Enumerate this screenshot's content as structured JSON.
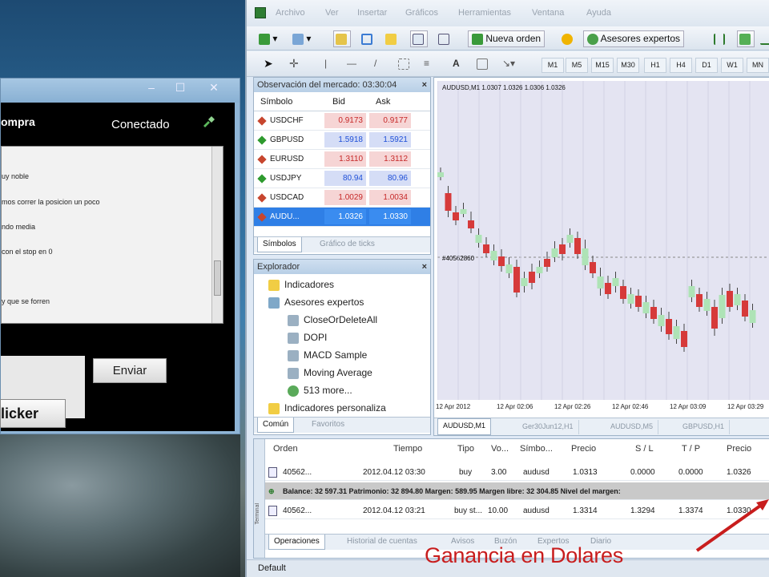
{
  "chat": {
    "title": "ompra",
    "status": "Conectado",
    "lines": [
      "uy noble",
      "mos correr la posicion un poco",
      "ndo media",
      "con el stop en 0",
      "y que se forren"
    ],
    "send_label": "Enviar",
    "clicker_label": "licker",
    "window_minimize": "–",
    "window_maximize": "☐",
    "window_close": "✕"
  },
  "menu": [
    "Archivo",
    "Ver",
    "Insertar",
    "Gráficos",
    "Herramientas",
    "Ventana",
    "Ayuda"
  ],
  "toolbar": {
    "new_order_label": "Nueva orden",
    "expert_advisors_label": "Asesores expertos"
  },
  "timeframes": [
    "M1",
    "M5",
    "M15",
    "M30",
    "H1",
    "H4",
    "D1",
    "W1",
    "MN"
  ],
  "market_watch": {
    "title": "Observación del mercado: 03:30:04",
    "col_symbol": "Símbolo",
    "col_bid": "Bid",
    "col_ask": "Ask",
    "rows": [
      {
        "symbol": "USDCHF",
        "bid": "0.9173",
        "ask": "0.9177",
        "color": "#c62828",
        "bg": "#f6d5d5"
      },
      {
        "symbol": "GBPUSD",
        "bid": "1.5918",
        "ask": "1.5921",
        "color": "#1e4fd8",
        "bg": "#d5ddf6"
      },
      {
        "symbol": "EURUSD",
        "bid": "1.3110",
        "ask": "1.3112",
        "color": "#c62828",
        "bg": "#f6d5d5"
      },
      {
        "symbol": "USDJPY",
        "bid": "80.94",
        "ask": "80.96",
        "color": "#1e4fd8",
        "bg": "#d5ddf6"
      },
      {
        "symbol": "USDCAD",
        "bid": "1.0029",
        "ask": "1.0034",
        "color": "#c62828",
        "bg": "#f6d5d5"
      },
      {
        "symbol": "AUDU...",
        "bid": "1.0326",
        "ask": "1.0330",
        "color": "#ffffff",
        "bg": "#2f7fe6"
      }
    ],
    "tabs": [
      "Símbolos",
      "Gráfico de ticks"
    ]
  },
  "navigator": {
    "title": "Explorador",
    "items": [
      "Indicadores",
      "Asesores expertos",
      "CloseOrDeleteAll",
      "DOPI",
      "MACD Sample",
      "Moving Average",
      "513 more...",
      "Indicadores personaliza"
    ],
    "tabs": [
      "Común",
      "Favoritos"
    ]
  },
  "chart": {
    "label": "AUDUSD,M1  1.0307 1.0326 1.0306 1.0326",
    "order_line_label": "#40562860",
    "x_labels": [
      "12 Apr 2012",
      "12 Apr 02:06",
      "12 Apr 02:26",
      "12 Apr 02:46",
      "12 Apr 03:09",
      "12 Apr 03:29"
    ],
    "tabs": [
      "AUDUSD,M1",
      "Ger30Jun12,H1",
      "AUDUSD,M5",
      "GBPUSD,H1"
    ]
  },
  "terminal": {
    "side_label": "Terminal",
    "headers": [
      "Orden",
      "Tiempo",
      "Tipo",
      "Vo...",
      "Símbo...",
      "Precio",
      "S / L",
      "T / P",
      "Precio"
    ],
    "rows": [
      [
        "40562...",
        "2012.04.12 03:30",
        "buy",
        "3.00",
        "audusd",
        "1.0313",
        "0.0000",
        "0.0000",
        "1.0326"
      ],
      [
        "40562...",
        "2012.04.12 03:21",
        "buy st...",
        "10.00",
        "audusd",
        "1.3314",
        "1.3294",
        "1.3374",
        "1.0330"
      ]
    ],
    "balance": "Balance: 32 597.31  Patrimonio: 32 894.80  Margen: 589.95  Margen libre: 32 304.85  Nivel del margen:",
    "tabs": [
      "Operaciones",
      "Historial de cuentas",
      "Avisos",
      "Buzón",
      "Expertos",
      "Diario"
    ]
  },
  "status_bar": "Default",
  "overlay": "Ganancia en Dolares",
  "candles": [
    [
      "u",
      210,
      216,
      210,
      216
    ],
    [
      "d",
      233,
      262,
      236,
      258
    ],
    [
      "d",
      258,
      272,
      260,
      270
    ],
    [
      "u",
      254,
      262,
      256,
      262
    ],
    [
      "d",
      265,
      282,
      270,
      280
    ],
    [
      "u",
      286,
      300,
      288,
      298
    ],
    [
      "d",
      297,
      312,
      300,
      311
    ],
    [
      "u",
      306,
      322,
      308,
      320
    ],
    [
      "d",
      312,
      330,
      315,
      327
    ],
    [
      "u",
      322,
      338,
      325,
      336
    ],
    [
      "d",
      325,
      362,
      328,
      360
    ],
    [
      "u",
      340,
      356,
      342,
      352
    ],
    [
      "d",
      330,
      352,
      334,
      348
    ],
    [
      "u",
      326,
      338,
      328,
      336
    ],
    [
      "d",
      315,
      330,
      318,
      328
    ],
    [
      "u",
      302,
      318,
      305,
      316
    ],
    [
      "d",
      298,
      316,
      300,
      312
    ],
    [
      "u",
      286,
      300,
      288,
      298
    ],
    [
      "d",
      290,
      314,
      292,
      312
    ],
    [
      "u",
      300,
      328,
      305,
      326
    ],
    [
      "d",
      320,
      338,
      322,
      336
    ],
    [
      "u",
      335,
      360,
      340,
      355
    ],
    [
      "d",
      345,
      364,
      348,
      362
    ],
    [
      "u",
      340,
      356,
      342,
      352
    ],
    [
      "d",
      350,
      370,
      352,
      368
    ],
    [
      "u",
      360,
      376,
      362,
      374
    ],
    [
      "d",
      362,
      380,
      364,
      378
    ],
    [
      "u",
      370,
      388,
      372,
      386
    ],
    [
      "d",
      375,
      395,
      378,
      393
    ],
    [
      "u",
      385,
      405,
      388,
      402
    ],
    [
      "d",
      390,
      415,
      393,
      412
    ],
    [
      "u",
      400,
      420,
      402,
      418
    ],
    [
      "d",
      405,
      430,
      408,
      428
    ],
    [
      "u",
      350,
      368,
      352,
      366
    ],
    [
      "d",
      360,
      380,
      362,
      378
    ],
    [
      "u",
      365,
      385,
      368,
      383
    ],
    [
      "d",
      375,
      410,
      378,
      405
    ],
    [
      "u",
      360,
      395,
      363,
      392
    ],
    [
      "d",
      355,
      380,
      358,
      378
    ],
    [
      "u",
      360,
      378,
      362,
      376
    ],
    [
      "d",
      368,
      392,
      370,
      390
    ],
    [
      "u",
      380,
      400,
      382,
      398
    ]
  ]
}
